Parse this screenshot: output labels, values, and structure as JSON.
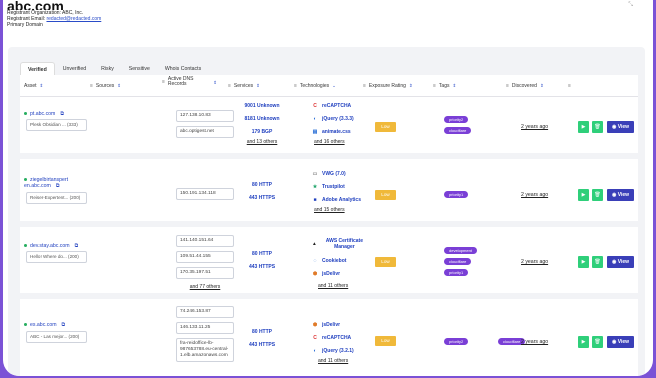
{
  "header": {
    "domain": "abc.com",
    "org_label": "Registrant Organization: ABC, Inc.",
    "email_label": "Registrant Email: ",
    "email_value": "redacted@redacted.com",
    "primary_label": "Primary Domain"
  },
  "tabs": [
    "Verified",
    "Unverified",
    "Risky",
    "Sensitive",
    "Whois Contacts"
  ],
  "columns": {
    "asset": "Asset",
    "sources": "Sources",
    "dns": "Active DNS Records",
    "services": "Services",
    "technologies": "Technologies",
    "rating": "Exposure Rating",
    "tags": "Tags",
    "discovered": "Discovered"
  },
  "actions": {
    "view": "View"
  },
  "rows": [
    {
      "asset": "pt.abc.com",
      "asset_desc": "Plesk Obsidian ... (333)",
      "dns": [
        "127.138.10.83",
        "abc.optigest.net"
      ],
      "services": [
        {
          "port": "9001",
          "name": "Unknown"
        },
        {
          "port": "8181",
          "name": "Unknown"
        },
        {
          "port": "179",
          "name": "BGP"
        }
      ],
      "services_more": "and 13 others",
      "tech": [
        "reCAPTCHA",
        "jQuery (3.3.3)",
        "animate.css"
      ],
      "tech_more": "and 16 others",
      "rating": "Low",
      "tags": [
        "priority2",
        "cloudflare"
      ],
      "discovered": "2 years ago"
    },
    {
      "asset": "ziegelbirtanspert en.abc.com",
      "asset_desc": "Reiser-Expertent... (200)",
      "dns": [
        "150.191.134.118"
      ],
      "services": [
        {
          "port": "80",
          "name": "HTTP"
        },
        {
          "port": "443",
          "name": "HTTPS"
        }
      ],
      "tech": [
        "VWG (7.0)",
        "Trustpilot",
        "Adobe Analytics"
      ],
      "tech_more": "and 15 others",
      "rating": "Low",
      "tags": [
        "priority1"
      ],
      "discovered": "2 years ago"
    },
    {
      "asset": "dev.stay.abc.com",
      "asset_desc": "Hello! Where do... (200)",
      "dns": [
        "141.140.151.64",
        "109.51.44.155",
        "170.35.197.51"
      ],
      "dns_more": "and 77 others",
      "services": [
        {
          "port": "80",
          "name": "HTTP"
        },
        {
          "port": "443",
          "name": "HTTPS"
        }
      ],
      "tech": [
        "AWS Certificate Manager",
        "Cookiebot",
        "jsDelivr"
      ],
      "tech_more": "and 11 others",
      "rating": "Low",
      "tags": [
        "development",
        "cloudflare",
        "priority1"
      ],
      "discovered": "2 years ago"
    },
    {
      "asset": "es.abc.com",
      "asset_desc": "ABC - Las mejor... (200)",
      "dns": [
        "74.246.153.87",
        "146.133.11.25",
        "fra-reidoffice-lb-987653788.eu-central-1.elb.amazonaws.com"
      ],
      "services": [
        {
          "port": "80",
          "name": "HTTP"
        },
        {
          "port": "443",
          "name": "HTTPS"
        }
      ],
      "tech": [
        "jsDelivr",
        "reCAPTCHA",
        "jQuery (3.2.1)"
      ],
      "tech_more": "and 11 others",
      "rating": "Low",
      "tags": [
        "priority2",
        "cloudflare"
      ],
      "discovered": "2 years ago"
    }
  ]
}
